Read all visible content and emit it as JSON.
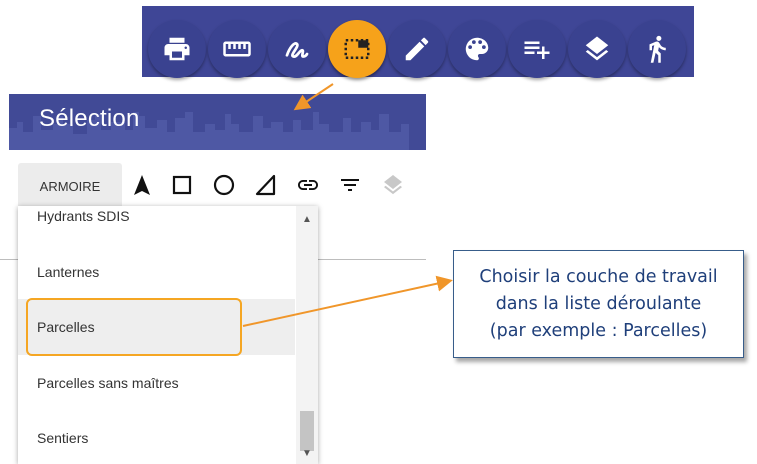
{
  "toolbar": {
    "buttons": [
      {
        "icon": "printer-icon",
        "active": false
      },
      {
        "icon": "ruler-icon",
        "active": false
      },
      {
        "icon": "freehand-icon",
        "active": false
      },
      {
        "icon": "selection-icon",
        "active": true
      },
      {
        "icon": "pencil-icon",
        "active": false
      },
      {
        "icon": "palette-icon",
        "active": false
      },
      {
        "icon": "playlist-add-icon",
        "active": false
      },
      {
        "icon": "layers-icon",
        "active": false
      },
      {
        "icon": "walk-icon",
        "active": false
      }
    ],
    "accent_color": "#f6a21a",
    "bar_color": "#3f4696"
  },
  "selection_panel": {
    "title": "Sélection",
    "layer_button": "ARMOIRE",
    "draw_tools": [
      "arrow-icon",
      "square-icon",
      "circle-icon",
      "triangle-icon",
      "link-icon",
      "filter-icon",
      "layers-disabled-icon"
    ]
  },
  "dropdown": {
    "items": [
      "Hydrants SDIS",
      "Lanternes",
      "Parcelles",
      "Parcelles sans maîtres",
      "Sentiers"
    ],
    "selected": "Parcelles"
  },
  "callout": {
    "lines": [
      "Choisir la couche de travail",
      "dans la liste déroulante",
      "(par exemple : Parcelles)"
    ]
  }
}
